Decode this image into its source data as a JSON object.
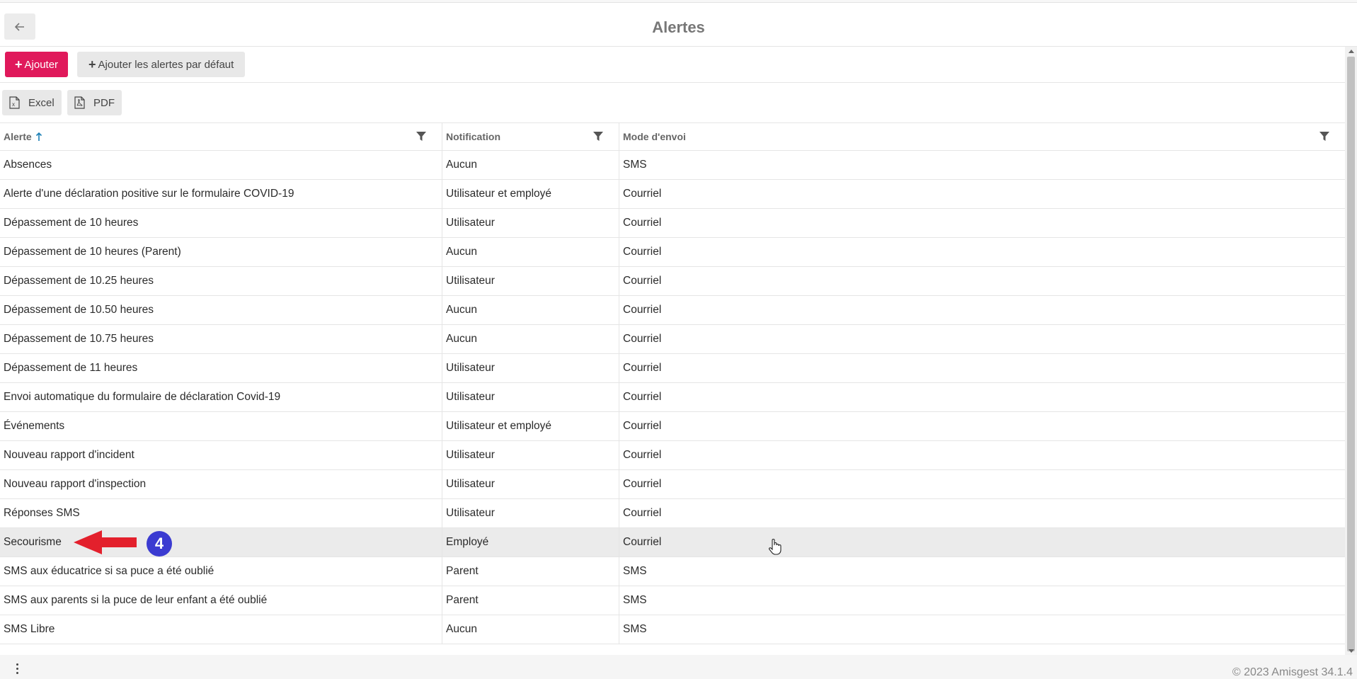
{
  "header": {
    "title": "Alertes",
    "back_icon": "arrow-left-icon"
  },
  "toolbar": {
    "add_label": "Ajouter",
    "add_defaults_label": "Ajouter les alertes par défaut"
  },
  "export": {
    "excel_label": "Excel",
    "pdf_label": "PDF"
  },
  "table": {
    "columns": [
      {
        "label": "Alerte",
        "sorted": "ascending"
      },
      {
        "label": "Notification"
      },
      {
        "label": "Mode d'envoi"
      }
    ],
    "rows": [
      {
        "alerte": "Absences",
        "notification": "Aucun",
        "mode": "SMS"
      },
      {
        "alerte": "Alerte d'une déclaration positive sur le formulaire COVID-19",
        "notification": "Utilisateur et employé",
        "mode": "Courriel"
      },
      {
        "alerte": "Dépassement de 10 heures",
        "notification": "Utilisateur",
        "mode": "Courriel"
      },
      {
        "alerte": "Dépassement de 10 heures (Parent)",
        "notification": "Aucun",
        "mode": "Courriel"
      },
      {
        "alerte": "Dépassement de 10.25 heures",
        "notification": "Utilisateur",
        "mode": "Courriel"
      },
      {
        "alerte": "Dépassement de 10.50 heures",
        "notification": "Aucun",
        "mode": "Courriel"
      },
      {
        "alerte": "Dépassement de 10.75 heures",
        "notification": "Aucun",
        "mode": "Courriel"
      },
      {
        "alerte": "Dépassement de 11 heures",
        "notification": "Utilisateur",
        "mode": "Courriel"
      },
      {
        "alerte": "Envoi automatique du formulaire de déclaration Covid-19",
        "notification": "Utilisateur",
        "mode": "Courriel"
      },
      {
        "alerte": "Événements",
        "notification": "Utilisateur et employé",
        "mode": "Courriel"
      },
      {
        "alerte": "Nouveau rapport d'incident",
        "notification": "Utilisateur",
        "mode": "Courriel"
      },
      {
        "alerte": "Nouveau rapport d'inspection",
        "notification": "Utilisateur",
        "mode": "Courriel"
      },
      {
        "alerte": "Réponses SMS",
        "notification": "Utilisateur",
        "mode": "Courriel"
      },
      {
        "alerte": "Secourisme",
        "notification": "Employé",
        "mode": "Courriel",
        "selected": true
      },
      {
        "alerte": "SMS aux éducatrice si sa puce a été oublié",
        "notification": "Parent",
        "mode": "SMS"
      },
      {
        "alerte": "SMS aux parents si la puce de leur enfant a été oublié",
        "notification": "Parent",
        "mode": "SMS"
      },
      {
        "alerte": "SMS Libre",
        "notification": "Aucun",
        "mode": "SMS"
      }
    ]
  },
  "annotation": {
    "step_number": "4",
    "arrow_color": "#e3202c",
    "badge_color": "#3b3bd1"
  },
  "footer": {
    "copyright": "© 2023 Amisgest 34.1.4"
  },
  "colors": {
    "primary": "#e0195b",
    "sort_arrow": "#1a7fb5"
  }
}
